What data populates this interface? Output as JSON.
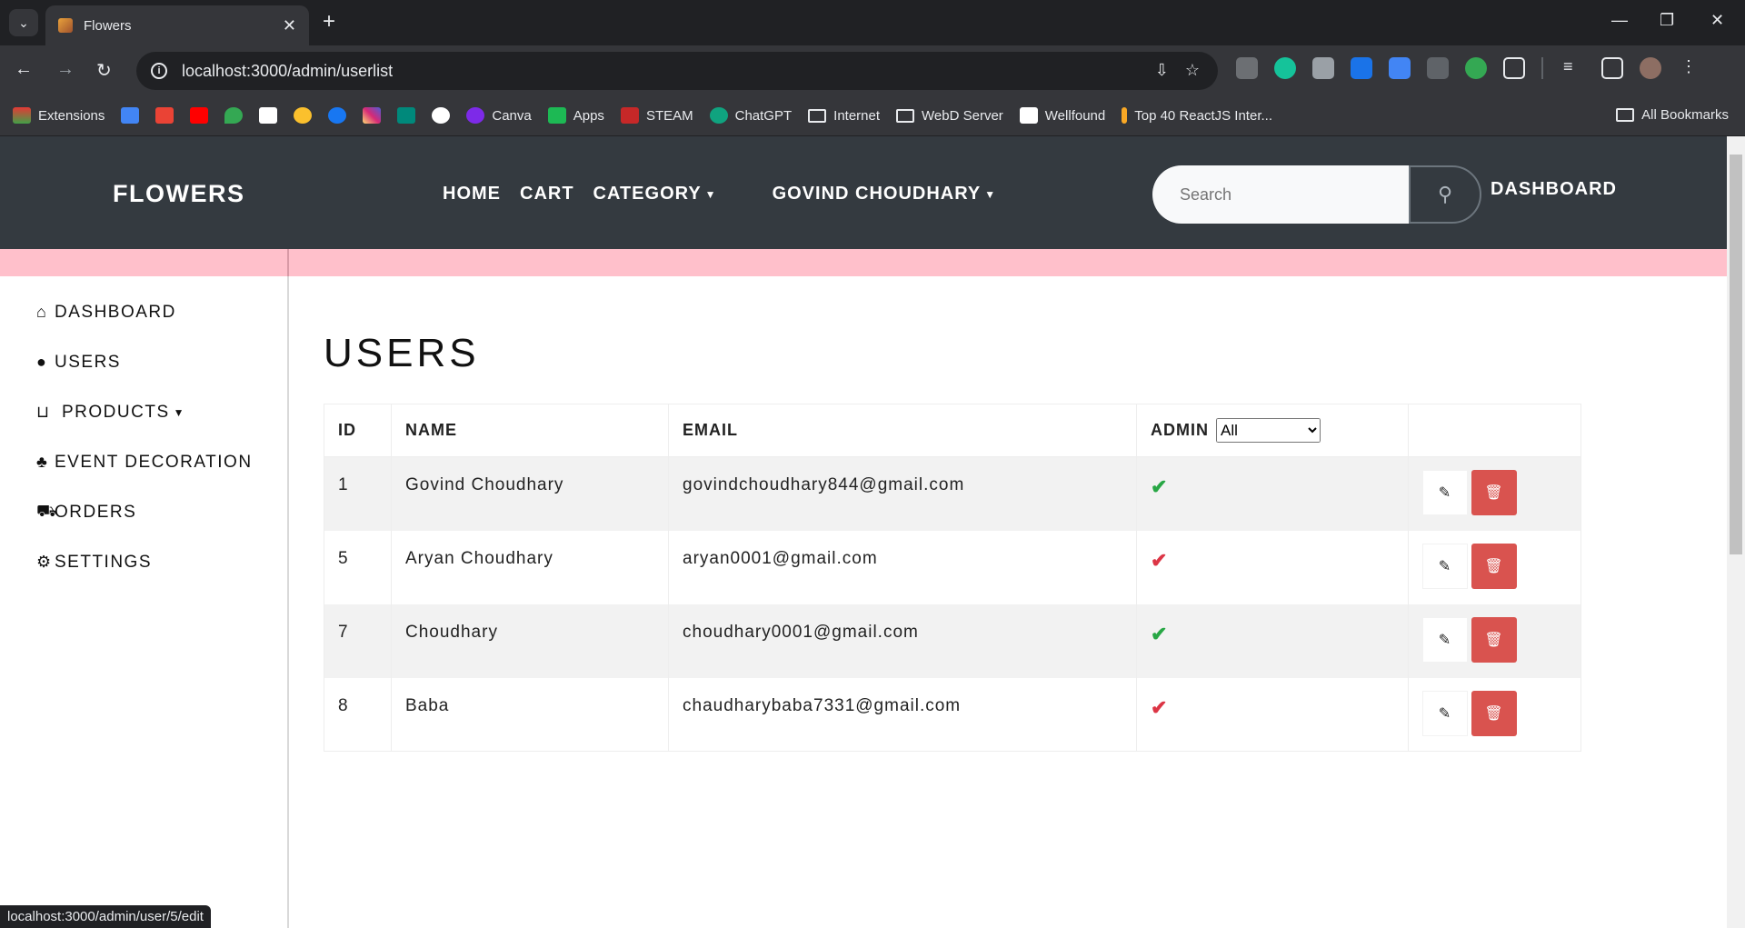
{
  "browser": {
    "tab_title": "Flowers",
    "url": "localhost:3000/admin/userlist",
    "status_url": "localhost:3000/admin/user/5/edit",
    "bookmarks": [
      "Extensions",
      "Canva",
      "Apps",
      "STEAM",
      "ChatGPT",
      "Internet",
      "WebD Server",
      "Wellfound",
      "Top 40 ReactJS Inter...",
      "All Bookmarks"
    ]
  },
  "site": {
    "brand": "FLOWERS",
    "menu": [
      "HOME",
      "CART",
      "CATEGORY",
      "GOVIND CHOUDHARY"
    ],
    "search_placeholder": "Search",
    "dashboard_link": "DASHBOARD"
  },
  "sidebar": {
    "items": [
      "DASHBOARD",
      "USERS",
      "PRODUCTS",
      "EVENT DECORATION",
      "ORDERS",
      "SETTINGS"
    ]
  },
  "main": {
    "title": "USERS",
    "columns": [
      "ID",
      "NAME",
      "EMAIL",
      "ADMIN"
    ],
    "admin_filter_selected": "All",
    "rows": [
      {
        "id": "1",
        "name": "Govind Choudhary",
        "email": "govindchoudhary844@gmail.com",
        "admin_mark": "✔"
      },
      {
        "id": "5",
        "name": "Aryan Choudhary",
        "email": "aryan0001@gmail.com",
        "admin_mark": "✔"
      },
      {
        "id": "7",
        "name": "Choudhary",
        "email": "choudhary0001@gmail.com",
        "admin_mark": "✔"
      },
      {
        "id": "8",
        "name": "Baba",
        "email": "chaudharybaba7331@gmail.com",
        "admin_mark": "✔"
      }
    ]
  },
  "colors": {
    "admin_true": "#28a745",
    "admin_false": "#dc3545",
    "nav_bg": "#343a40",
    "strip": "#ffc0cb",
    "delete": "#d9534f"
  }
}
